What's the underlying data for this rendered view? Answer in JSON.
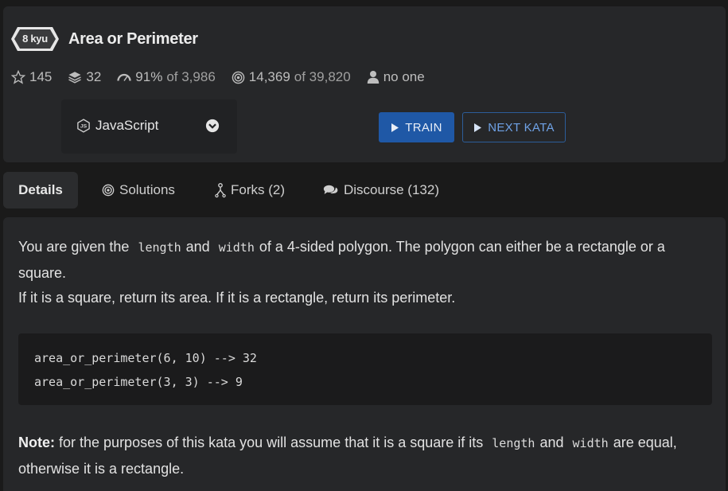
{
  "kata": {
    "rank": "8 kyu",
    "title": "Area or Perimeter"
  },
  "stats": {
    "stars": "145",
    "collections": "32",
    "satisfaction": "91%",
    "satisfaction_of": "of 3,986",
    "completed": "14,369",
    "completed_of": "of 39,820",
    "author": "no one"
  },
  "language": {
    "selected": "JavaScript"
  },
  "buttons": {
    "train": "TRAIN",
    "next": "NEXT KATA"
  },
  "tabs": {
    "details": "Details",
    "solutions": "Solutions",
    "forks": "Forks (2)",
    "discourse": "Discourse (132)"
  },
  "description": {
    "p1_a": "You are given the",
    "p1_code1": "length",
    "p1_b": "and",
    "p1_code2": "width",
    "p1_c": "of a 4-sided polygon. The polygon can either be a rectangle or a square.",
    "p2": "If it is a square, return its area. If it is a rectangle, return its perimeter.",
    "code_line1": "area_or_perimeter(6, 10) --> 32",
    "code_line2": "area_or_perimeter(3, 3) --> 9",
    "note_label": "Note:",
    "note_a": "for the purposes of this kata you will assume that it is a square if its",
    "note_code1": "length",
    "note_b": "and",
    "note_code2": "width",
    "note_c": "are equal, otherwise it is a rectangle."
  },
  "colors": {
    "background": "#1a1a1a",
    "card": "#262729",
    "train_button": "#1f58a6",
    "next_button_text": "#6fa2e6"
  }
}
